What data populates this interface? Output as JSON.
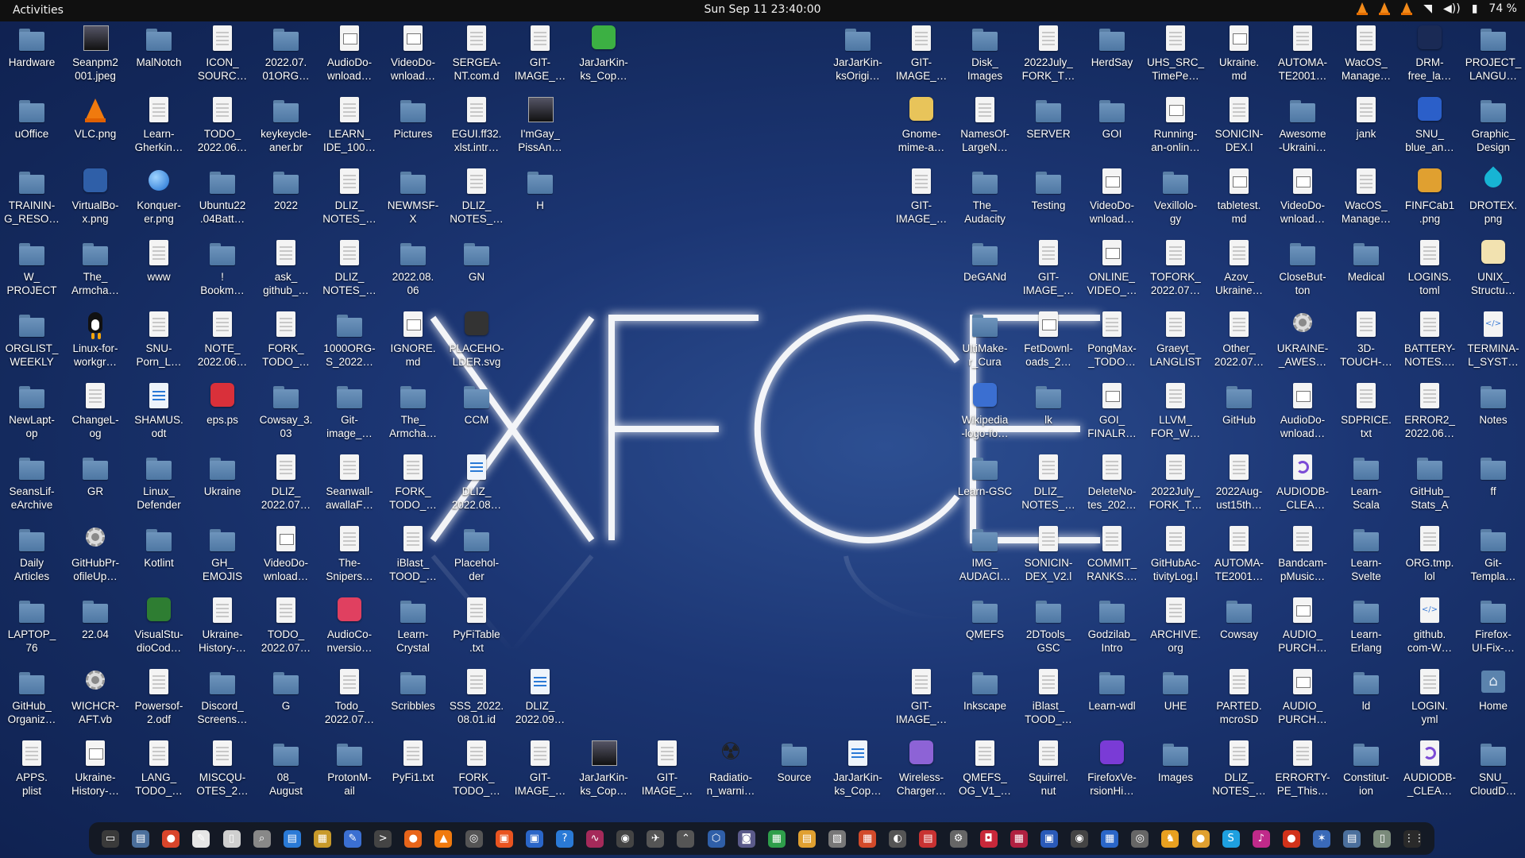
{
  "topbar": {
    "activities": "Activities",
    "clock": "Sun Sep 11  23:40:00",
    "battery": "74 %"
  },
  "wallpaper": {
    "logo_text": "XFCE"
  },
  "desktop_icons": [
    {
      "label": "Hardware",
      "kind": "folder"
    },
    {
      "label": "Seanpm2 001.jpeg",
      "kind": "photo"
    },
    {
      "label": "MalNotch",
      "kind": "folder"
    },
    {
      "label": "ICON_ SOURC…",
      "kind": "file"
    },
    {
      "label": "2022.07. 01ORG…",
      "kind": "folder"
    },
    {
      "label": "AudioDo- wnload…",
      "kind": "image"
    },
    {
      "label": "VideoDo- wnload…",
      "kind": "image"
    },
    {
      "label": "SERGEA- NT.com.d",
      "kind": "file"
    },
    {
      "label": "GIT- IMAGE_…",
      "kind": "file"
    },
    {
      "label": "JarJarKin- ks_Cop…",
      "kind": "app",
      "color": "#3cb043"
    },
    {
      "label": "uOffice",
      "kind": "folder"
    },
    {
      "label": "VLC.png",
      "kind": "vlc"
    },
    {
      "label": "Learn- Gherkin…",
      "kind": "file"
    },
    {
      "label": "TODO_ 2022.06…",
      "kind": "file"
    },
    {
      "label": "keykeycle- aner.br",
      "kind": "folder"
    },
    {
      "label": "LEARN_ IDE_100…",
      "kind": "file"
    },
    {
      "label": "Pictures",
      "kind": "folder"
    },
    {
      "label": "EGUI.ff32. xlst.intr…",
      "kind": "file"
    },
    {
      "label": "I'mGay_ PissAn…",
      "kind": "photo"
    },
    {
      "label": "TRAININ- G_RESO…",
      "kind": "folder"
    },
    {
      "label": "VirtualBo- x.png",
      "kind": "app",
      "color": "#2f5fa8"
    },
    {
      "label": "Konquer- er.png",
      "kind": "globe"
    },
    {
      "label": "Ubuntu22 .04Batt…",
      "kind": "folder"
    },
    {
      "label": "2022",
      "kind": "folder"
    },
    {
      "label": "DLIZ_ NOTES_…",
      "kind": "file"
    },
    {
      "label": "NEWMSF- X",
      "kind": "folder"
    },
    {
      "label": "DLIZ_ NOTES_…",
      "kind": "file"
    },
    {
      "label": "H",
      "kind": "folder"
    },
    {
      "label": "W_ PROJECT",
      "kind": "folder"
    },
    {
      "label": "The_ Armcha…",
      "kind": "folder"
    },
    {
      "label": "www",
      "kind": "file"
    },
    {
      "label": "! Bookm…",
      "kind": "folder"
    },
    {
      "label": "ask_ github_…",
      "kind": "file"
    },
    {
      "label": "DLIZ_ NOTES_…",
      "kind": "file"
    },
    {
      "label": "2022.08. 06",
      "kind": "folder"
    },
    {
      "label": "GN",
      "kind": "folder"
    },
    {
      "label": "ORGLIST_ WEEKLY",
      "kind": "folder"
    },
    {
      "label": "Linux-for- workgr…",
      "kind": "tux"
    },
    {
      "label": "SNU- Porn_L…",
      "kind": "file"
    },
    {
      "label": "NOTE_ 2022.06…",
      "kind": "file"
    },
    {
      "label": "FORK_ TODO_…",
      "kind": "file"
    },
    {
      "label": "1000ORG- S_2022…",
      "kind": "folder"
    },
    {
      "label": "IGNORE. md",
      "kind": "image"
    },
    {
      "label": "PLACEHO- LDER.svg",
      "kind": "app",
      "color": "#333"
    },
    {
      "label": "NewLapt- op",
      "kind": "folder"
    },
    {
      "label": "ChangeL- og",
      "kind": "file"
    },
    {
      "label": "SHAMUS. odt",
      "kind": "doc"
    },
    {
      "label": "eps.ps",
      "kind": "app",
      "color": "#d9303a"
    },
    {
      "label": "Cowsay_3. 03",
      "kind": "folder"
    },
    {
      "label": "Git- image_…",
      "kind": "folder"
    },
    {
      "label": "The_ Armcha…",
      "kind": "folder"
    },
    {
      "label": "CCM",
      "kind": "folder"
    },
    {
      "label": "SeansLif- eArchive",
      "kind": "folder"
    },
    {
      "label": "GR",
      "kind": "folder"
    },
    {
      "label": "Linux_ Defender",
      "kind": "folder"
    },
    {
      "label": "Ukraine",
      "kind": "folder"
    },
    {
      "label": "DLIZ_ 2022.07…",
      "kind": "file"
    },
    {
      "label": "Seanwall- awallaF…",
      "kind": "file"
    },
    {
      "label": "FORK_ TODO_…",
      "kind": "file"
    },
    {
      "label": "DLIZ_ 2022.08…",
      "kind": "doc"
    },
    {
      "label": "Daily Articles",
      "kind": "folder"
    },
    {
      "label": "GitHubPr- ofileUp…",
      "kind": "gear"
    },
    {
      "label": "Kotlint",
      "kind": "folder"
    },
    {
      "label": "GH_ EMOJIS",
      "kind": "folder"
    },
    {
      "label": "VideoDo- wnload…",
      "kind": "image"
    },
    {
      "label": "The- Snipers…",
      "kind": "file"
    },
    {
      "label": "iBlast_ TOOD_…",
      "kind": "file"
    },
    {
      "label": "Placehol- der",
      "kind": "folder"
    },
    {
      "label": "LAPTOP_ 76",
      "kind": "folder"
    },
    {
      "label": "22.04",
      "kind": "folder"
    },
    {
      "label": "VisualStu- dioCod…",
      "kind": "app",
      "color": "#2e7d32"
    },
    {
      "label": "Ukraine- History-…",
      "kind": "file"
    },
    {
      "label": "TODO_ 2022.07…",
      "kind": "file"
    },
    {
      "label": "AudioCo- nversio…",
      "kind": "app",
      "color": "#e04060"
    },
    {
      "label": "Learn- Crystal",
      "kind": "folder"
    },
    {
      "label": "PyFiTable .txt",
      "kind": "file"
    },
    {
      "label": "GitHub_ Organiz…",
      "kind": "folder"
    },
    {
      "label": "WICHCR- AFT.vb",
      "kind": "gear"
    },
    {
      "label": "Powersof- 2.odf",
      "kind": "file"
    },
    {
      "label": "Discord_ Screens…",
      "kind": "folder"
    },
    {
      "label": "G",
      "kind": "folder"
    },
    {
      "label": "Todo_ 2022.07…",
      "kind": "file"
    },
    {
      "label": "Scribbles",
      "kind": "folder"
    },
    {
      "label": "SSS_2022. 08.01.id",
      "kind": "file"
    },
    {
      "label": "DLIZ_ 2022.09…",
      "kind": "doc"
    },
    {
      "label": "APPS. plist",
      "kind": "file"
    },
    {
      "label": "Ukraine- History-…",
      "kind": "image"
    },
    {
      "label": "LANG_ TODO_…",
      "kind": "file"
    },
    {
      "label": "MISCQU- OTES_2…",
      "kind": "file"
    },
    {
      "label": "08_ August",
      "kind": "folder"
    },
    {
      "label": "ProtonM- ail",
      "kind": "folder"
    },
    {
      "label": "PyFi1.txt",
      "kind": "file"
    },
    {
      "label": "FORK_ TODO_…",
      "kind": "file"
    },
    {
      "label": "GIT- IMAGE_…",
      "kind": "file"
    },
    {
      "label": "JarJarKin- ks_Cop…",
      "kind": "photo"
    },
    {
      "label": "GIT- IMAGE_…",
      "kind": "file"
    },
    {
      "label": "Radiatio- n_warni…",
      "kind": "rad"
    },
    {
      "label": "Source",
      "kind": "folder"
    },
    {
      "label": "JarJarKin- ks_Cop…",
      "kind": "doc"
    },
    {
      "label": "Wireless- Charger…",
      "kind": "app",
      "color": "#8d63d6"
    },
    {
      "label": "QMEFS_ OG_V1_…",
      "kind": "file"
    },
    {
      "label": "Squirrel. nut",
      "kind": "file"
    },
    {
      "label": "FirefoxVe- rsionHi…",
      "kind": "app",
      "color": "#7a3bd6"
    },
    {
      "label": "Images",
      "kind": "folder"
    },
    {
      "label": "DLIZ_ NOTES_…",
      "kind": "file"
    },
    {
      "label": "ERRORTY- PE_This…",
      "kind": "file"
    },
    {
      "label": "Constitut- ion",
      "kind": "folder"
    },
    {
      "label": "AUDIODB- _CLEA…",
      "kind": "purple"
    },
    {
      "label": "SNU_ CloudD…",
      "kind": "folder"
    },
    {
      "label": "JarJarKin- ksOrigi…",
      "kind": "folder"
    },
    {
      "label": "GIT- IMAGE_…",
      "kind": "file"
    },
    {
      "label": "Disk_ Images",
      "kind": "folder"
    },
    {
      "label": "2022July_ FORK_T…",
      "kind": "file"
    },
    {
      "label": "HerdSay",
      "kind": "folder"
    },
    {
      "label": "UHS_SRC_ TimePe…",
      "kind": "file"
    },
    {
      "label": "Ukraine. md",
      "kind": "image"
    },
    {
      "label": "AUTOMA- TE2001…",
      "kind": "file"
    },
    {
      "label": "WacOS_ Manage…",
      "kind": "file"
    },
    {
      "label": "DRM- free_la…",
      "kind": "app",
      "color": "#1a2a55"
    },
    {
      "label": "PROJECT_ LANGU…",
      "kind": "folder"
    },
    {
      "label": "Gnome- mime-a…",
      "kind": "app",
      "color": "#e8c45a"
    },
    {
      "label": "NamesOf- LargeN…",
      "kind": "file"
    },
    {
      "label": "SERVER",
      "kind": "folder"
    },
    {
      "label": "GOI",
      "kind": "folder"
    },
    {
      "label": "Running- an-onlin…",
      "kind": "image"
    },
    {
      "label": "SONICIN- DEX.l",
      "kind": "file"
    },
    {
      "label": "Awesome -Ukraini…",
      "kind": "folder"
    },
    {
      "label": "jank",
      "kind": "file"
    },
    {
      "label": "SNU_ blue_an…",
      "kind": "app",
      "color": "#2b5fc9"
    },
    {
      "label": "Graphic_ Design",
      "kind": "folder"
    },
    {
      "label": "GIT- IMAGE_…",
      "kind": "file"
    },
    {
      "label": "The_ Audacity",
      "kind": "folder"
    },
    {
      "label": "Testing",
      "kind": "folder"
    },
    {
      "label": "VideoDo- wnload…",
      "kind": "image"
    },
    {
      "label": "Vexillolo- gy",
      "kind": "folder"
    },
    {
      "label": "tabletest. md",
      "kind": "image"
    },
    {
      "label": "VideoDo- wnload…",
      "kind": "image"
    },
    {
      "label": "WacOS_ Manage…",
      "kind": "file"
    },
    {
      "label": "FINFCab1 .png",
      "kind": "app",
      "color": "#e0a030"
    },
    {
      "label": "DROTEX. png",
      "kind": "drop"
    },
    {
      "label": "DeGANd",
      "kind": "folder"
    },
    {
      "label": "GIT- IMAGE_…",
      "kind": "file"
    },
    {
      "label": "ONLINE_ VIDEO_…",
      "kind": "image"
    },
    {
      "label": "TOFORK_ 2022.07…",
      "kind": "file"
    },
    {
      "label": "Azov_ Ukraine…",
      "kind": "file"
    },
    {
      "label": "CloseBut- ton",
      "kind": "folder"
    },
    {
      "label": "Medical",
      "kind": "folder"
    },
    {
      "label": "LOGINS. toml",
      "kind": "file"
    },
    {
      "label": "UNIX_ Structu…",
      "kind": "app",
      "color": "#f2e2b0"
    },
    {
      "label": "UltiMake- r_Cura",
      "kind": "folder"
    },
    {
      "label": "FetDownl- oads_2…",
      "kind": "image"
    },
    {
      "label": "PongMax- _TODO…",
      "kind": "file"
    },
    {
      "label": "Graeyt_ LANGLIST",
      "kind": "file"
    },
    {
      "label": "Other_ 2022.07…",
      "kind": "file"
    },
    {
      "label": "UKRAINE- _AWES…",
      "kind": "gear"
    },
    {
      "label": "3D- TOUCH-…",
      "kind": "file"
    },
    {
      "label": "BATTERY- NOTES.…",
      "kind": "file"
    },
    {
      "label": "TERMINA- L_SYST…",
      "kind": "code"
    },
    {
      "label": "Wikipedia -logo-fo…",
      "kind": "app",
      "color": "#3b6fd1"
    },
    {
      "label": "lk",
      "kind": "folder"
    },
    {
      "label": "GOI_ FINALR…",
      "kind": "image"
    },
    {
      "label": "LLVM_ FOR_W…",
      "kind": "file"
    },
    {
      "label": "GitHub",
      "kind": "folder"
    },
    {
      "label": "AudioDo- wnload…",
      "kind": "image"
    },
    {
      "label": "SDPRICE. txt",
      "kind": "file"
    },
    {
      "label": "ERROR2_ 2022.06…",
      "kind": "file"
    },
    {
      "label": "Notes",
      "kind": "folder"
    },
    {
      "label": "Learn-GSC",
      "kind": "folder"
    },
    {
      "label": "DLIZ_ NOTES_…",
      "kind": "file"
    },
    {
      "label": "DeleteNo- tes_202…",
      "kind": "file"
    },
    {
      "label": "2022July_ FORK_T…",
      "kind": "file"
    },
    {
      "label": "2022Aug- ust15th…",
      "kind": "file"
    },
    {
      "label": "AUDIODB- _CLEA…",
      "kind": "purple"
    },
    {
      "label": "Learn- Scala",
      "kind": "folder"
    },
    {
      "label": "GitHub_ Stats_A",
      "kind": "folder"
    },
    {
      "label": "ff",
      "kind": "folder"
    },
    {
      "label": "IMG_ AUDACI…",
      "kind": "folder"
    },
    {
      "label": "SONICIN- DEX_V2.l",
      "kind": "file"
    },
    {
      "label": "COMMIT_ RANKS.…",
      "kind": "file"
    },
    {
      "label": "GitHubAc- tivityLog.l",
      "kind": "file"
    },
    {
      "label": "AUTOMA- TE2001…",
      "kind": "file"
    },
    {
      "label": "Bandcam- pMusic…",
      "kind": "file"
    },
    {
      "label": "Learn- Svelte",
      "kind": "folder"
    },
    {
      "label": "ORG.tmp. lol",
      "kind": "file"
    },
    {
      "label": "Git- Templa…",
      "kind": "folder"
    },
    {
      "label": "QMEFS",
      "kind": "folder"
    },
    {
      "label": "2DTools_ GSC",
      "kind": "folder"
    },
    {
      "label": "Godzilab_ Intro",
      "kind": "folder"
    },
    {
      "label": "ARCHIVE. org",
      "kind": "file"
    },
    {
      "label": "Cowsay",
      "kind": "folder"
    },
    {
      "label": "AUDIO_ PURCH…",
      "kind": "image"
    },
    {
      "label": "Learn- Erlang",
      "kind": "folder"
    },
    {
      "label": "github. com-W…",
      "kind": "code"
    },
    {
      "label": "Firefox- UI-Fix-…",
      "kind": "folder"
    },
    {
      "label": "GIT- IMAGE_…",
      "kind": "file"
    },
    {
      "label": "Inkscape",
      "kind": "folder"
    },
    {
      "label": "iBlast_ TOOD_…",
      "kind": "file"
    },
    {
      "label": "Learn-wdl",
      "kind": "folder"
    },
    {
      "label": "UHE",
      "kind": "folder"
    },
    {
      "label": "PARTED. mcroSD",
      "kind": "file"
    },
    {
      "label": "AUDIO_ PURCH…",
      "kind": "image"
    },
    {
      "label": "ld",
      "kind": "folder"
    },
    {
      "label": "LOGIN. yml",
      "kind": "file"
    },
    {
      "label": "Home",
      "kind": "home"
    }
  ],
  "dock": {
    "items": [
      {
        "name": "terminal",
        "color": "#3a3a3a",
        "glyph": "▭"
      },
      {
        "name": "files",
        "color": "#4b6f9c",
        "glyph": "▤"
      },
      {
        "name": "chrome",
        "color": "#d9452b",
        "glyph": "●"
      },
      {
        "name": "text-editor",
        "color": "#e6e6e6",
        "glyph": "✎"
      },
      {
        "name": "notes",
        "color": "#cfcfcf",
        "glyph": "▯"
      },
      {
        "name": "search",
        "color": "#888888",
        "glyph": "⌕"
      },
      {
        "name": "writer",
        "color": "#2a7ad6",
        "glyph": "▤"
      },
      {
        "name": "archive",
        "color": "#c89a2a",
        "glyph": "▦"
      },
      {
        "name": "editor",
        "color": "#3b6fd1",
        "glyph": "✎"
      },
      {
        "name": "console",
        "color": "#444444",
        "glyph": ">"
      },
      {
        "name": "firefox",
        "color": "#e8651a",
        "glyph": "●"
      },
      {
        "name": "vlc",
        "color": "#f07a0e",
        "glyph": "▲"
      },
      {
        "name": "disks",
        "color": "#555555",
        "glyph": "◎"
      },
      {
        "name": "ubuntu-software",
        "color": "#e95420",
        "glyph": "▣"
      },
      {
        "name": "monitor",
        "color": "#2a66c8",
        "glyph": "▣"
      },
      {
        "name": "help",
        "color": "#2a7ad6",
        "glyph": "?"
      },
      {
        "name": "activity",
        "color": "#a52a5a",
        "glyph": "∿"
      },
      {
        "name": "media",
        "color": "#444444",
        "glyph": "◉"
      },
      {
        "name": "tool-a",
        "color": "#555555",
        "glyph": "✈"
      },
      {
        "name": "tool-b",
        "color": "#555555",
        "glyph": "⌃"
      },
      {
        "name": "virtualbox",
        "color": "#2f5fa8",
        "glyph": "⬡"
      },
      {
        "name": "tool-c",
        "color": "#5a5a8a",
        "glyph": "◙"
      },
      {
        "name": "calc",
        "color": "#2e9e4a",
        "glyph": "▦"
      },
      {
        "name": "pdf",
        "color": "#e0a030",
        "glyph": "▤"
      },
      {
        "name": "doc",
        "color": "#777777",
        "glyph": "▧"
      },
      {
        "name": "office",
        "color": "#d24a2a",
        "glyph": "▦"
      },
      {
        "name": "steam",
        "color": "#555555",
        "glyph": "◐"
      },
      {
        "name": "store",
        "color": "#c83232",
        "glyph": "▤"
      },
      {
        "name": "settings",
        "color": "#666666",
        "glyph": "⚙"
      },
      {
        "name": "camera",
        "color": "#c8283a",
        "glyph": "◘"
      },
      {
        "name": "tool-d",
        "color": "#b02040",
        "glyph": "▦"
      },
      {
        "name": "screens",
        "color": "#2a5ab8",
        "glyph": "▣"
      },
      {
        "name": "tool-e",
        "color": "#444444",
        "glyph": "◉"
      },
      {
        "name": "grid",
        "color": "#2a66c8",
        "glyph": "▦"
      },
      {
        "name": "tool-f",
        "color": "#666666",
        "glyph": "◎"
      },
      {
        "name": "game",
        "color": "#e8a020",
        "glyph": "♞"
      },
      {
        "name": "tool-g",
        "color": "#e0a030",
        "glyph": "●"
      },
      {
        "name": "skype",
        "color": "#1ea0e0",
        "glyph": "S"
      },
      {
        "name": "tool-h",
        "color": "#c02a8a",
        "glyph": "♪"
      },
      {
        "name": "tool-i",
        "color": "#d2321a",
        "glyph": "●"
      },
      {
        "name": "tool-j",
        "color": "#3a6ab8",
        "glyph": "✶"
      },
      {
        "name": "files-2",
        "color": "#4b6f9c",
        "glyph": "▤"
      },
      {
        "name": "trash",
        "color": "#7a8a7a",
        "glyph": "▯"
      },
      {
        "name": "app-grid",
        "color": "#2a2a2a",
        "glyph": "⋮⋮"
      }
    ]
  }
}
